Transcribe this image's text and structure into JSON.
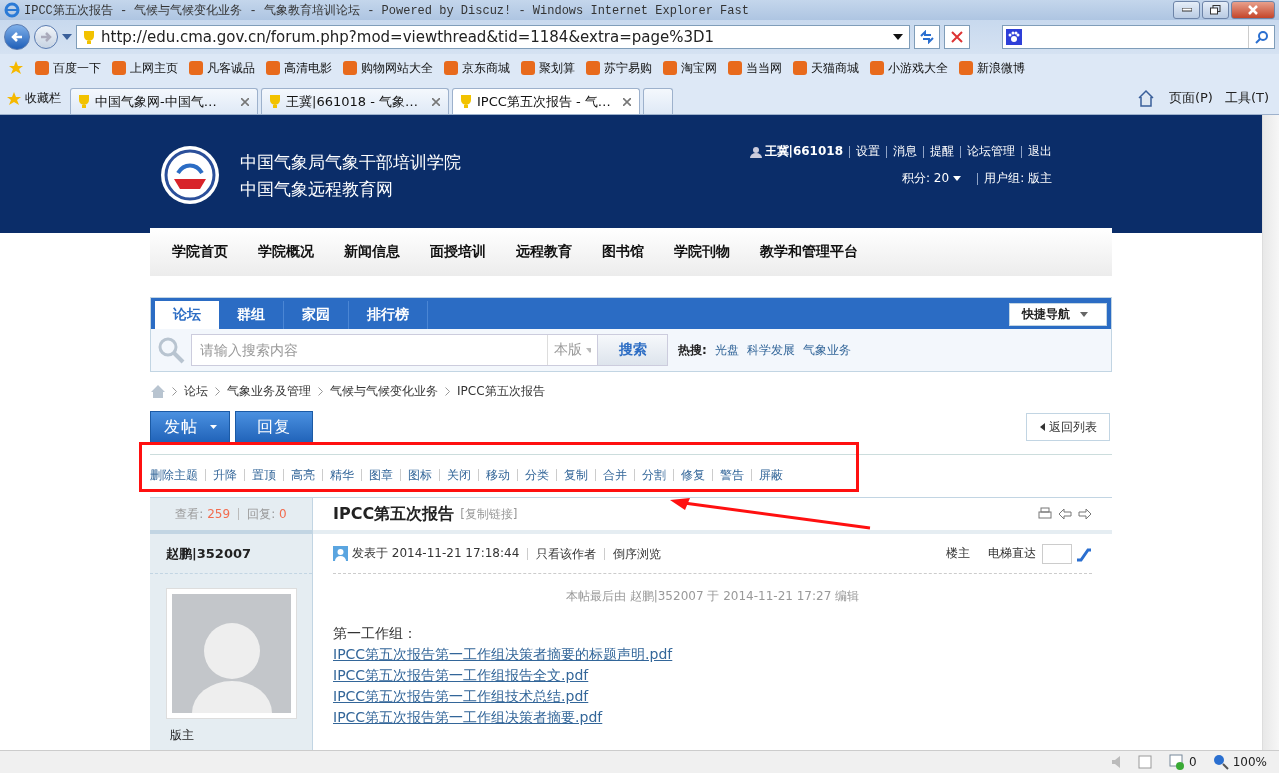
{
  "window": {
    "title": "IPCC第五次报告 - 气候与气候变化业务 - 气象教育培训论坛 - Powered by Discuz! - Windows Internet Explorer Fast"
  },
  "address": {
    "url": "http://edu.cma.gov.cn/forum.php?mod=viewthread&tid=1184&extra=page%3D1"
  },
  "favorites": [
    "百度一下",
    "上网主页",
    "凡客诚品",
    "高清电影",
    "购物网站大全",
    "京东商城",
    "聚划算",
    "苏宁易购",
    "淘宝网",
    "当当网",
    "天猫商城",
    "小游戏大全",
    "新浪微博"
  ],
  "browser_tabs": {
    "favorites_label": "收藏栏",
    "tabs": [
      {
        "label": "中国气象网-中国气…",
        "selected": false
      },
      {
        "label": "王冀|661018 - 气象…",
        "selected": false
      },
      {
        "label": "IPCC第五次报告 - 气…",
        "selected": true
      }
    ]
  },
  "command_bar": [
    "页面(P)",
    "工具(T)"
  ],
  "site": {
    "title_lines": [
      "中国气象局气象干部培训学院",
      "中国气象远程教育网"
    ],
    "user": "王冀|661018",
    "user_links": [
      "设置",
      "消息",
      "提醒",
      "论坛管理",
      "退出"
    ],
    "credits": "积分: 20",
    "group": "用户组: 版主"
  },
  "nav": [
    "学院首页",
    "学院概况",
    "新闻信息",
    "面授培训",
    "远程教育",
    "图书馆",
    "学院刊物",
    "教学和管理平台"
  ],
  "forum_tabs": [
    {
      "label": "论坛",
      "selected": true
    },
    {
      "label": "群组",
      "selected": false
    },
    {
      "label": "家园",
      "selected": false
    },
    {
      "label": "排行榜",
      "selected": false
    }
  ],
  "quick_nav": "快捷导航",
  "search": {
    "placeholder": "请输入搜索内容",
    "scope": "本版",
    "button": "搜索",
    "hot_label": "热搜:",
    "hot": [
      "光盘",
      "科学发展",
      "气象业务"
    ]
  },
  "breadcrumb": [
    "论坛",
    "气象业务及管理",
    "气候与气候变化业务",
    "IPCC第五次报告"
  ],
  "actions": {
    "post": "发帖",
    "reply": "回复",
    "back": "返回列表"
  },
  "mod_actions": [
    "删除主题",
    "升降",
    "置顶",
    "高亮",
    "精华",
    "图章",
    "图标",
    "关闭",
    "移动",
    "分类",
    "复制",
    "合并",
    "分割",
    "修复",
    "警告",
    "屏蔽"
  ],
  "thread": {
    "views_label": "查看:",
    "views": "259",
    "replies_label": "回复:",
    "replies": "0",
    "title": "IPCC第五次报告",
    "copy_link": "[复制链接]"
  },
  "post": {
    "author": "赵鹏|352007",
    "role": "版主",
    "posted": "发表于 2014-11-21 17:18:44",
    "author_only": "只看该作者",
    "reverse": "倒序浏览",
    "floor": "楼主",
    "jump_label": "电梯直达",
    "edit_note": "本帖最后由 赵鹏|352007 于 2014-11-21 17:27 编辑",
    "heading": "第一工作组：",
    "attachments": [
      "IPCC第五次报告第一工作组决策者摘要的标题声明.pdf",
      "IPCC第五次报告第一工作组报告全文.pdf",
      "IPCC第五次报告第一工作组技术总结.pdf",
      "IPCC第五次报告第一工作组决策者摘要.pdf"
    ]
  },
  "status_bar": {
    "popups": "0",
    "zoom": "100%"
  }
}
